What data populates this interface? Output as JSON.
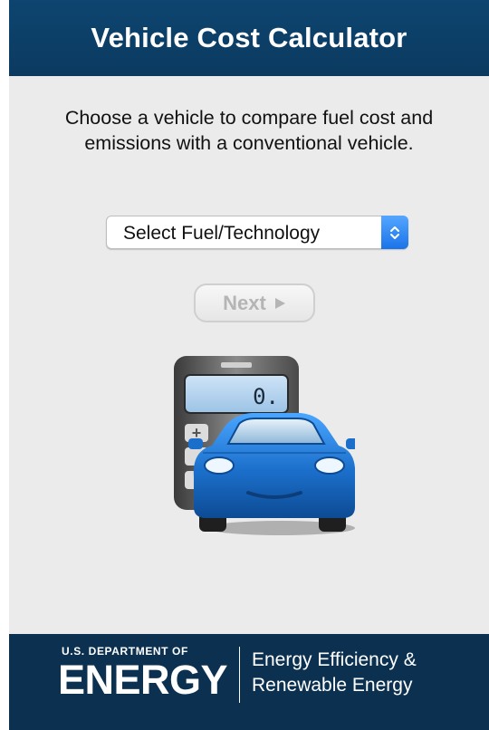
{
  "header": {
    "title": "Vehicle Cost Calculator"
  },
  "intro": {
    "text": "Choose a vehicle to compare fuel cost and emissions with a conventional vehicle."
  },
  "fuel_select": {
    "selected": "Select Fuel/Technology",
    "icon": "chevron-updown-icon"
  },
  "next_button": {
    "label": "Next",
    "icon": "play-arrow-icon",
    "state": "disabled"
  },
  "illustration": {
    "calculator_display": "0."
  },
  "footer": {
    "doe_small": "U.S. DEPARTMENT OF",
    "doe_big": "ENERGY",
    "eere_line1": "Energy Efficiency &",
    "eere_line2": "Renewable Energy"
  },
  "colors": {
    "header_bg": "#0b3a60",
    "footer_bg": "#0b3050",
    "accent_blue": "#1a73e8",
    "car_blue": "#1b6fcb"
  }
}
